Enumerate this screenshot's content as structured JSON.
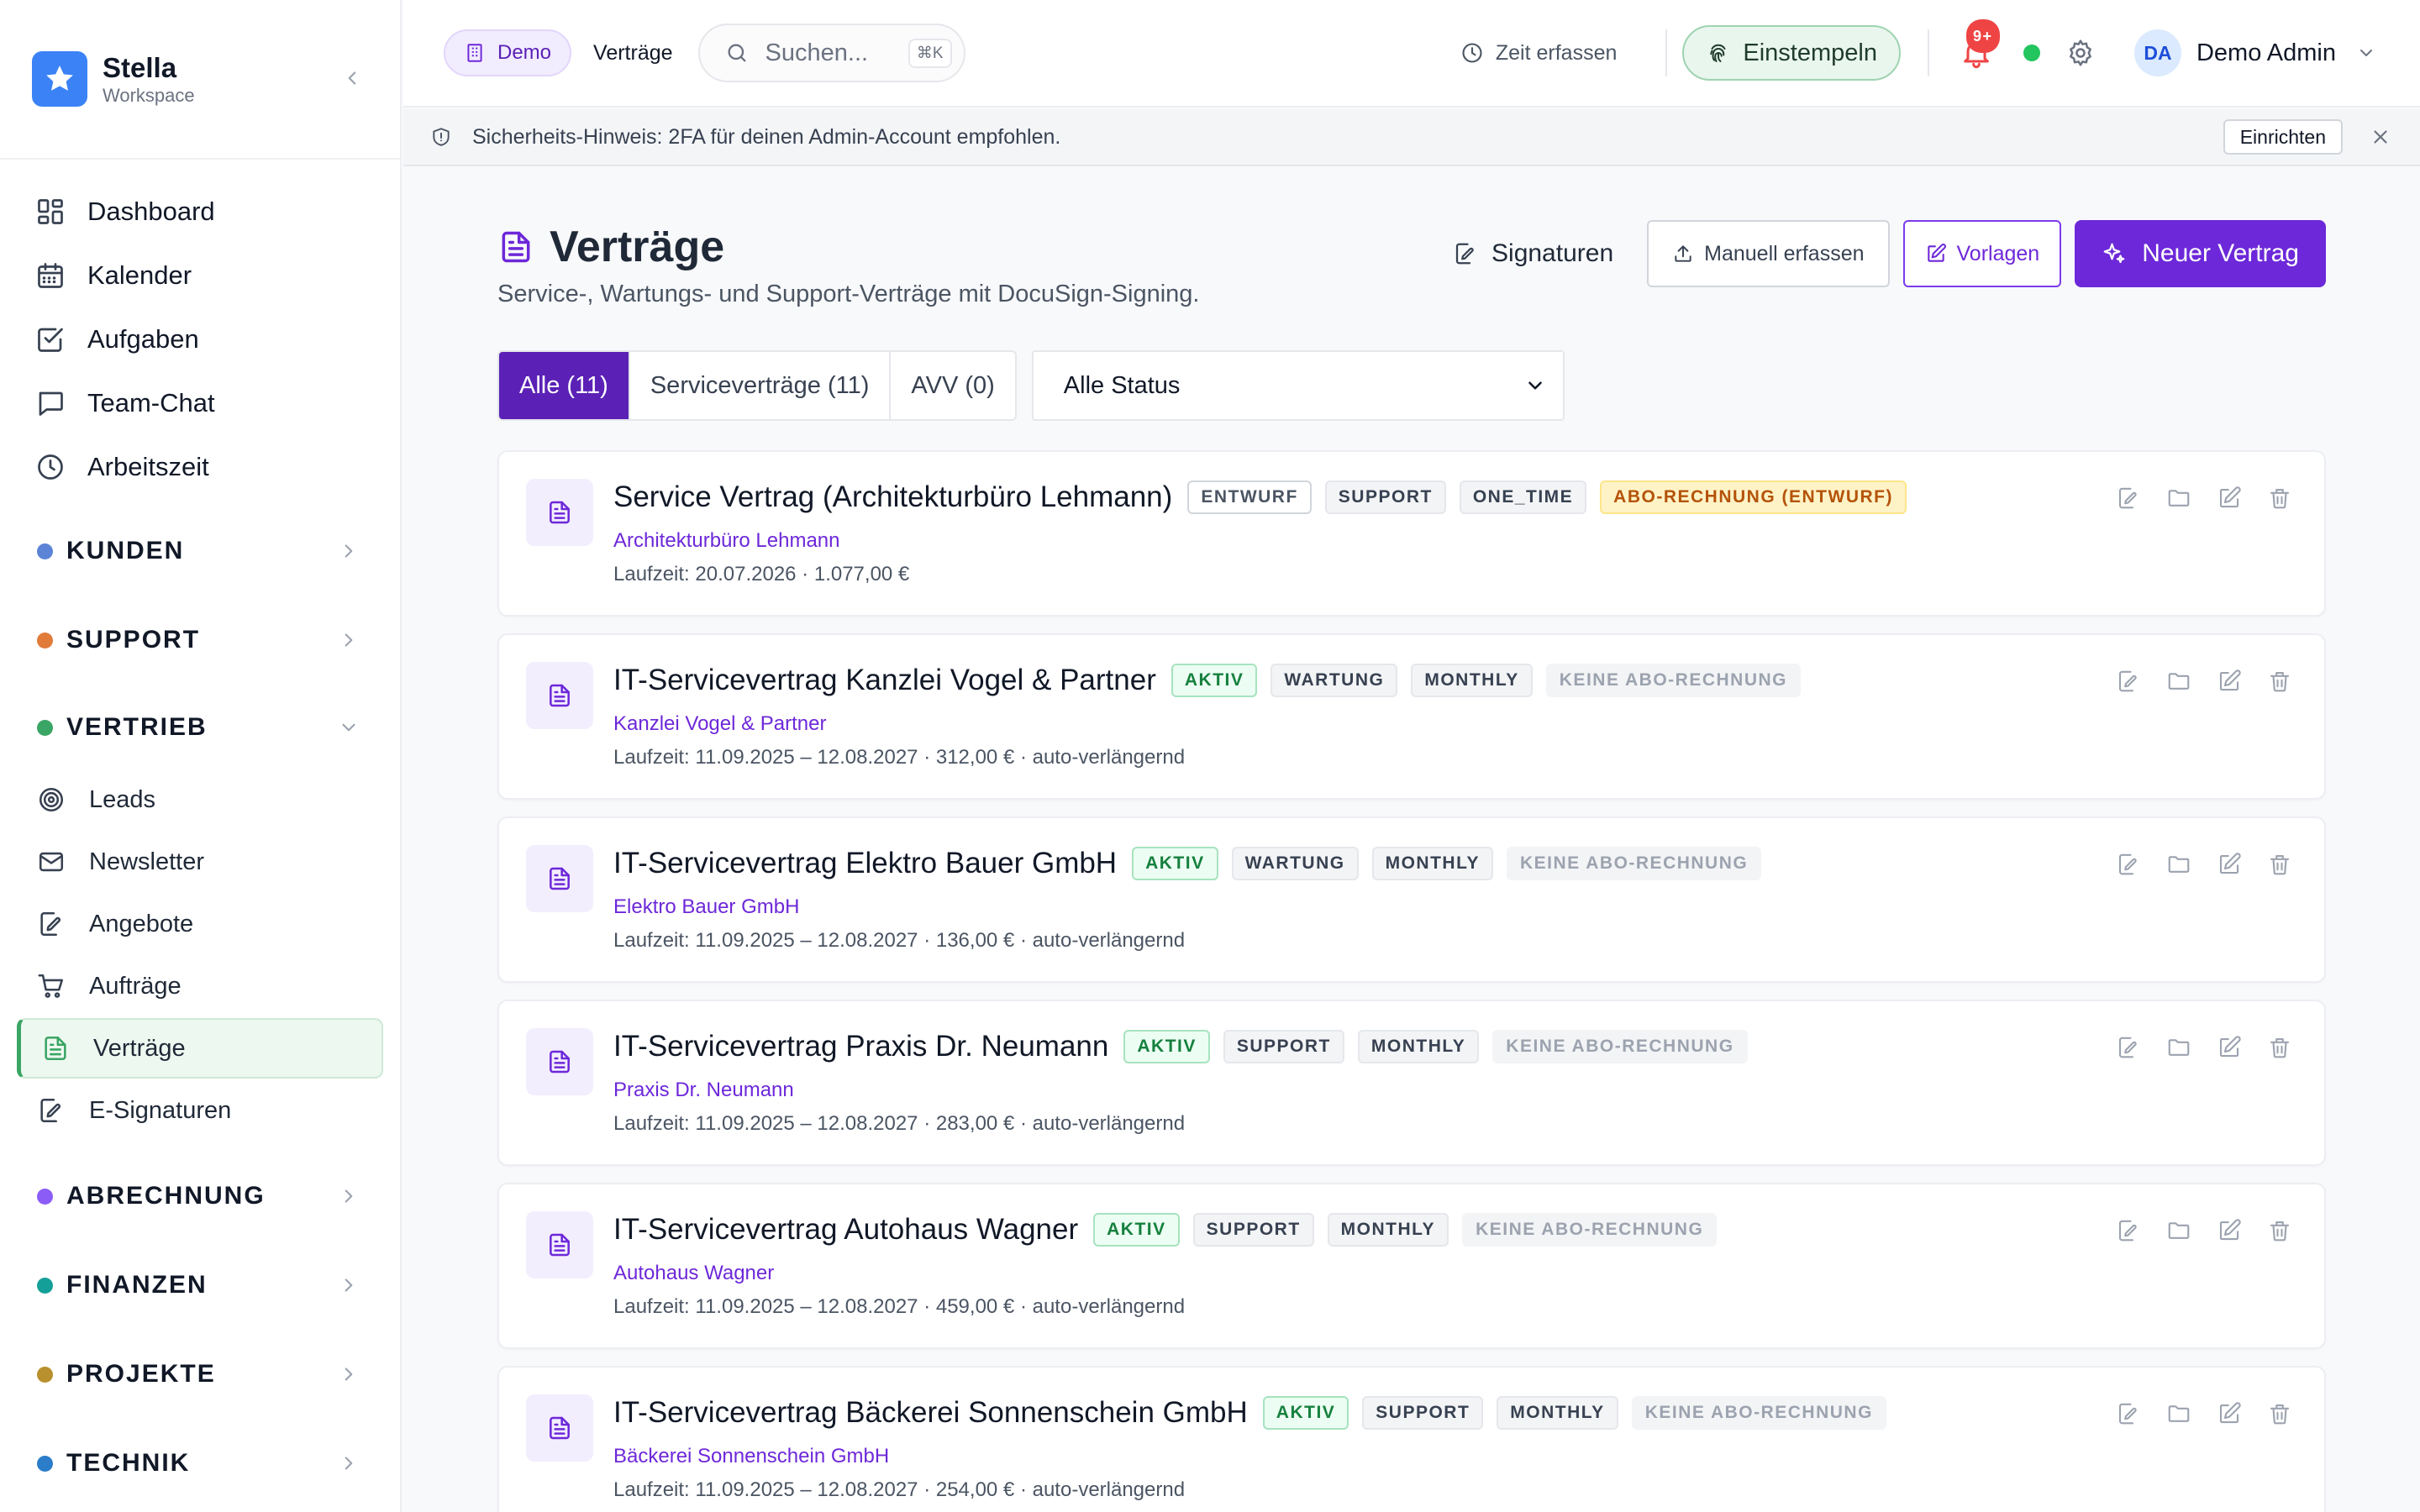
{
  "brand": {
    "name": "Stella",
    "sub": "Workspace"
  },
  "nav_main": [
    {
      "label": "Dashboard",
      "icon": "dashboard-icon"
    },
    {
      "label": "Kalender",
      "icon": "calendar-icon"
    },
    {
      "label": "Aufgaben",
      "icon": "checkbox-icon"
    },
    {
      "label": "Team-Chat",
      "icon": "chat-icon"
    },
    {
      "label": "Arbeitszeit",
      "icon": "clock-icon"
    }
  ],
  "sections": {
    "kunden": {
      "label": "KUNDEN",
      "color": "#5b84d6"
    },
    "support": {
      "label": "SUPPORT",
      "color": "#e07b39"
    },
    "vertrieb": {
      "label": "VERTRIEB",
      "color": "#3aa564"
    },
    "abrechnung": {
      "label": "ABRECHNUNG",
      "color": "#8b5cf6"
    },
    "finanzen": {
      "label": "FINANZEN",
      "color": "#14a098"
    },
    "projekte": {
      "label": "PROJEKTE",
      "color": "#b8902d"
    },
    "technik": {
      "label": "TECHNIK",
      "color": "#2b7dc9"
    }
  },
  "vertrieb_items": [
    {
      "label": "Leads",
      "icon": "target-icon"
    },
    {
      "label": "Newsletter",
      "icon": "mail-icon"
    },
    {
      "label": "Angebote",
      "icon": "edit-doc-icon"
    },
    {
      "label": "Aufträge",
      "icon": "cart-icon"
    },
    {
      "label": "Verträge",
      "icon": "document-icon"
    },
    {
      "label": "E-Signaturen",
      "icon": "signature-icon"
    }
  ],
  "topbar": {
    "demo": "Demo",
    "link": "Verträge",
    "search_placeholder": "Suchen...",
    "search_shortcut": "⌘K",
    "time": "Zeit erfassen",
    "clockin": "Einstempeln",
    "notif_count": "9+",
    "avatar": "DA",
    "user": "Demo Admin"
  },
  "banner": {
    "text": "Sicherheits-Hinweis: 2FA für deinen Admin-Account empfohlen.",
    "button": "Einrichten"
  },
  "page": {
    "title": "Verträge",
    "subtitle": "Service-, Wartungs- und Support-Verträge mit DocuSign-Signing.",
    "actions": {
      "signatures": "Signaturen",
      "manual": "Manuell erfassen",
      "templates": "Vorlagen",
      "new": "Neuer Vertrag"
    }
  },
  "filters": {
    "tabs": [
      "Alle (11)",
      "Serviceverträge (11)",
      "AVV (0)"
    ],
    "status": "Alle Status"
  },
  "contracts": [
    {
      "title": "Service Vertrag (Architekturbüro Lehmann)",
      "badges": [
        {
          "text": "ENTWURF",
          "style": "outline"
        },
        {
          "text": "SUPPORT",
          "style": "gray"
        },
        {
          "text": "ONE_TIME",
          "style": "gray"
        },
        {
          "text": "ABO-RECHNUNG (ENTWURF)",
          "style": "amber"
        }
      ],
      "customer": "Architekturbüro Lehmann",
      "meta": "Laufzeit: 20.07.2026 · 1.077,00 €"
    },
    {
      "title": "IT-Servicevertrag Kanzlei Vogel & Partner",
      "badges": [
        {
          "text": "AKTIV",
          "style": "green"
        },
        {
          "text": "WARTUNG",
          "style": "gray"
        },
        {
          "text": "MONTHLY",
          "style": "gray"
        },
        {
          "text": "KEINE ABO-RECHNUNG",
          "style": "gray-light"
        }
      ],
      "customer": "Kanzlei Vogel & Partner",
      "meta": "Laufzeit: 11.09.2025 – 12.08.2027 · 312,00 € · auto-verlängernd"
    },
    {
      "title": "IT-Servicevertrag Elektro Bauer GmbH",
      "badges": [
        {
          "text": "AKTIV",
          "style": "green"
        },
        {
          "text": "WARTUNG",
          "style": "gray"
        },
        {
          "text": "MONTHLY",
          "style": "gray"
        },
        {
          "text": "KEINE ABO-RECHNUNG",
          "style": "gray-light"
        }
      ],
      "customer": "Elektro Bauer GmbH",
      "meta": "Laufzeit: 11.09.2025 – 12.08.2027 · 136,00 € · auto-verlängernd"
    },
    {
      "title": "IT-Servicevertrag Praxis Dr. Neumann",
      "badges": [
        {
          "text": "AKTIV",
          "style": "green"
        },
        {
          "text": "SUPPORT",
          "style": "gray"
        },
        {
          "text": "MONTHLY",
          "style": "gray"
        },
        {
          "text": "KEINE ABO-RECHNUNG",
          "style": "gray-light"
        }
      ],
      "customer": "Praxis Dr. Neumann",
      "meta": "Laufzeit: 11.09.2025 – 12.08.2027 · 283,00 € · auto-verlängernd"
    },
    {
      "title": "IT-Servicevertrag Autohaus Wagner",
      "badges": [
        {
          "text": "AKTIV",
          "style": "green"
        },
        {
          "text": "SUPPORT",
          "style": "gray"
        },
        {
          "text": "MONTHLY",
          "style": "gray"
        },
        {
          "text": "KEINE ABO-RECHNUNG",
          "style": "gray-light"
        }
      ],
      "customer": "Autohaus Wagner",
      "meta": "Laufzeit: 11.09.2025 – 12.08.2027 · 459,00 € · auto-verlängernd"
    },
    {
      "title": "IT-Servicevertrag Bäckerei Sonnenschein GmbH",
      "badges": [
        {
          "text": "AKTIV",
          "style": "green"
        },
        {
          "text": "SUPPORT",
          "style": "gray"
        },
        {
          "text": "MONTHLY",
          "style": "gray"
        },
        {
          "text": "KEINE ABO-RECHNUNG",
          "style": "gray-light"
        }
      ],
      "customer": "Bäckerei Sonnenschein GmbH",
      "meta": "Laufzeit: 11.09.2025 – 12.08.2027 · 254,00 € · auto-verlängernd"
    }
  ]
}
